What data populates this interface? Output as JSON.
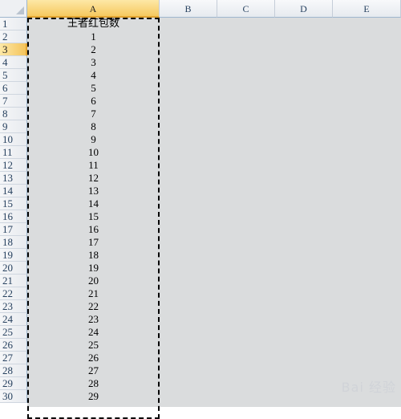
{
  "columns": [
    "A",
    "B",
    "C",
    "D",
    "E"
  ],
  "rows": [
    "1",
    "2",
    "3",
    "4",
    "5",
    "6",
    "7",
    "8",
    "9",
    "10",
    "11",
    "12",
    "13",
    "14",
    "15",
    "16",
    "17",
    "18",
    "19",
    "20",
    "21",
    "22",
    "23",
    "24",
    "25",
    "26",
    "27",
    "28",
    "29",
    "30"
  ],
  "selected_column": "A",
  "selected_row": "3",
  "cells_A": [
    "王者红包数",
    "1",
    "2",
    "3",
    "4",
    "5",
    "6",
    "7",
    "8",
    "9",
    "10",
    "11",
    "12",
    "13",
    "14",
    "15",
    "16",
    "17",
    "18",
    "19",
    "20",
    "21",
    "22",
    "23",
    "24",
    "25",
    "26",
    "27",
    "28",
    "29"
  ],
  "watermark": "Bai 经验"
}
